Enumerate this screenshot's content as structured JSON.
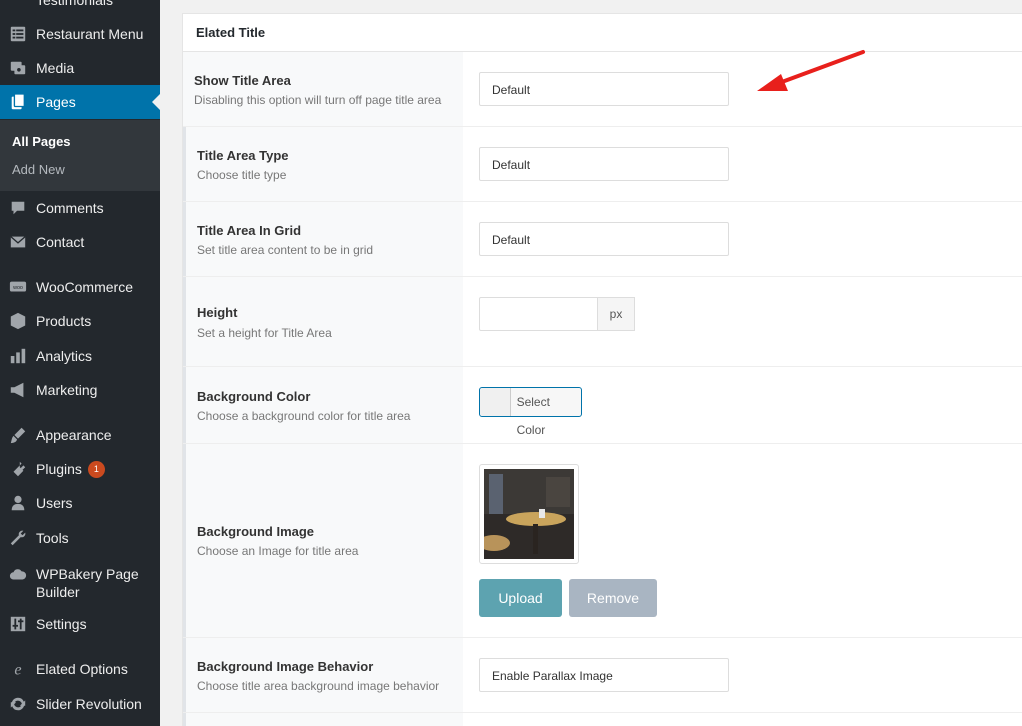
{
  "sidebar": {
    "items": [
      {
        "label": "Testimonials"
      },
      {
        "label": "Restaurant Menu"
      },
      {
        "label": "Media"
      },
      {
        "label": "Pages"
      },
      {
        "label": "Comments"
      },
      {
        "label": "Contact"
      },
      {
        "label": "WooCommerce"
      },
      {
        "label": "Products"
      },
      {
        "label": "Analytics"
      },
      {
        "label": "Marketing"
      },
      {
        "label": "Appearance"
      },
      {
        "label": "Plugins",
        "badge": "1"
      },
      {
        "label": "Users"
      },
      {
        "label": "Tools"
      },
      {
        "label_line1": "WPBakery Page",
        "label_line2": "Builder"
      },
      {
        "label": "Settings"
      },
      {
        "label": "Elated Options"
      },
      {
        "label": "Slider Revolution"
      }
    ],
    "submenu": {
      "all_pages": "All Pages",
      "add_new": "Add New"
    }
  },
  "panel": {
    "header": "Elated Title",
    "rows": [
      {
        "title": "Show Title Area",
        "desc": "Disabling this option will turn off page title area",
        "value": "Default"
      },
      {
        "title": "Title Area Type",
        "desc": "Choose title type",
        "value": "Default"
      },
      {
        "title": "Title Area In Grid",
        "desc": "Set title area content to be in grid",
        "value": "Default"
      },
      {
        "title": "Height",
        "desc": "Set a height for Title Area",
        "value": "",
        "addon": "px"
      },
      {
        "title": "Background Color",
        "desc": "Choose a background color for title area",
        "button": "Select Color"
      },
      {
        "title": "Background Image",
        "desc": "Choose an Image for title area",
        "upload": "Upload",
        "remove": "Remove"
      },
      {
        "title": "Background Image Behavior",
        "desc": "Choose title area background image behavior",
        "value": "Enable Parallax Image"
      }
    ]
  },
  "colors": {
    "sidebar_bg": "#23282d",
    "active": "#0073aa",
    "upload_btn": "#5da3b0",
    "remove_btn": "#a9b5c2",
    "arrow": "#e8201c"
  }
}
